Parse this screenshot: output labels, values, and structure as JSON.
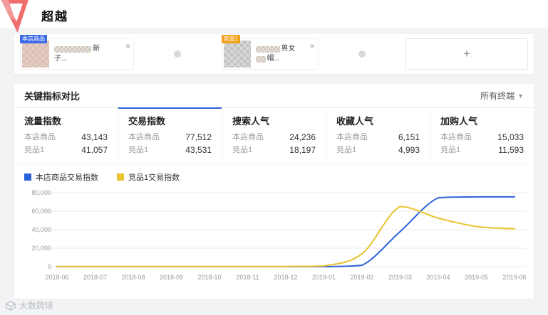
{
  "brand": {
    "title": "超越"
  },
  "watermark": {
    "label": "大数跨境"
  },
  "selector": {
    "items": [
      {
        "badge": "本店商品",
        "badge_color": "#3a68e8",
        "line1_suffix": "新",
        "line2": "子...",
        "close": "×"
      },
      {
        "badge": "竞品1",
        "badge_color": "#f0a21a",
        "line1_suffix": "男女",
        "line2": "帽...",
        "close": "×"
      }
    ],
    "add_label": "+"
  },
  "panel": {
    "title": "关键指标对比",
    "terminal_filter": "所有终端",
    "store_label": "本店商品",
    "competitor_label": "竞品1",
    "metrics": [
      {
        "label": "流量指数",
        "store_value": "43,143",
        "competitor_value": "41,057",
        "active": false
      },
      {
        "label": "交易指数",
        "store_value": "77,512",
        "competitor_value": "43,531",
        "active": true
      },
      {
        "label": "搜索人气",
        "store_value": "24,236",
        "competitor_value": "18,197",
        "active": false
      },
      {
        "label": "收藏人气",
        "store_value": "6,151",
        "competitor_value": "4,993",
        "active": false
      },
      {
        "label": "加购人气",
        "store_value": "15,033",
        "competitor_value": "11,593",
        "active": false
      }
    ]
  },
  "legend": [
    {
      "label": "本店商品交易指数",
      "color": "#2c62d9"
    },
    {
      "label": "竞品1交易指数",
      "color": "#e9c42e"
    }
  ],
  "chart_data": {
    "type": "line",
    "title": "",
    "x": [
      "2018-06",
      "2018-07",
      "2018-08",
      "2018-09",
      "2018-10",
      "2018-11",
      "2018-12",
      "2019-01",
      "2019-02",
      "2019-03",
      "2019-04",
      "2019-05",
      "2019-06"
    ],
    "series": [
      {
        "name": "本店商品交易指数",
        "color": "#2c62d9",
        "values": [
          0,
          0,
          0,
          0,
          0,
          0,
          0,
          0,
          1500,
          38000,
          74500,
          75500,
          75500
        ]
      },
      {
        "name": "竞品1交易指数",
        "color": "#e9c42e",
        "values": [
          200,
          200,
          200,
          200,
          200,
          200,
          200,
          800,
          14000,
          65000,
          52500,
          43500,
          41000
        ]
      }
    ],
    "xlabel": "",
    "ylabel": "",
    "ylim": [
      0,
      80000
    ],
    "yticks": [
      0,
      20000,
      40000,
      60000,
      80000
    ],
    "ytick_labels": [
      "0",
      "20,000",
      "40,000",
      "60,000",
      "80,000"
    ],
    "grid": true,
    "legend_position": "top-left"
  }
}
